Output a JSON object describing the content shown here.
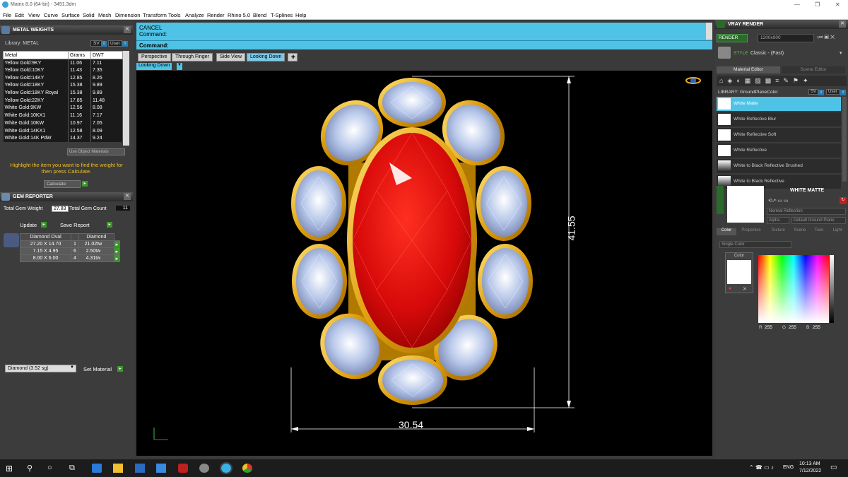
{
  "window": {
    "title": "Matrix 8.0 (64-bit) - 3491.3dm"
  },
  "menu": [
    "File",
    "Edit",
    "View",
    "Curve",
    "Surface",
    "Solid",
    "Mesh",
    "Dimension",
    "Transform",
    "Tools",
    "Analyze",
    "Render",
    "Rhino 5.0",
    "Blend",
    "T-Splines",
    "Help"
  ],
  "metal_weights": {
    "title": "METAL WEIGHTS",
    "library": "Library: METAL",
    "lib_btn_1": "SV",
    "lib_btn_2": "User",
    "columns": [
      "Metal",
      "Grams",
      "DWT"
    ],
    "rows": [
      [
        "Yellow Gold:9KY",
        "11.06",
        "7.11"
      ],
      [
        "Yellow Gold:10KY",
        "11.43",
        "7.35"
      ],
      [
        "Yellow Gold:14KY",
        "12.85",
        "8.26"
      ],
      [
        "Yellow Gold:18KY",
        "15.38",
        "9.89"
      ],
      [
        "Yellow Gold:18KY Royal",
        "15.38",
        "9.89"
      ],
      [
        "Yellow Gold:22KY",
        "17.85",
        "11.48"
      ],
      [
        "White Gold:9KW",
        "12.56",
        "8.08"
      ],
      [
        "White Gold:10KX1",
        "11.16",
        "7.17"
      ],
      [
        "White Gold:10KW",
        "10.97",
        "7.05"
      ],
      [
        "White Gold:14KX1",
        "12.58",
        "8.09"
      ],
      [
        "White Gold:14K PdW",
        "14.37",
        "9.24"
      ]
    ],
    "use_object_materials": "Use Object Materials",
    "hint": "Highlight the item you want to find the weight for then press Calculate.",
    "calculate": "Calculate"
  },
  "gem_reporter": {
    "title": "GEM REPORTER",
    "total_weight_label": "Total Gem Weight",
    "total_weight": "27.83",
    "total_count_label": "Total Gem Count",
    "total_count": "11",
    "update": "Update",
    "save_report": "Save Report",
    "columns": [
      "Diamond Oval",
      "",
      "Diamond"
    ],
    "rows": [
      [
        "27.20 X 14.70",
        "1",
        "21.02tw"
      ],
      [
        "7.15 X 4.95",
        "6",
        "2.50tw"
      ],
      [
        "8.00 X 6.00",
        "4",
        "4.31tw"
      ]
    ],
    "material_select": "Diamond    (3.52 sg)",
    "set_material": "Set Material"
  },
  "command": {
    "line1": "CANCEL",
    "line2": "Command:",
    "prompt": "Command:"
  },
  "view_tabs": [
    "Perspective",
    "Through Finger",
    "Side View",
    "Looking Down"
  ],
  "active_view": "Looking Down",
  "dimensions": {
    "height": "41.55",
    "width": "30.54"
  },
  "vray": {
    "title": "VRAY RENDER",
    "render_btn": "RENDER",
    "resolution": "1200x900",
    "style_label": "STYLE",
    "style_value": "Classic - (Fast)",
    "tab_material": "Material Editor",
    "tab_scene": "Scene Editor",
    "library": "LIBRARY: GroundPlaneColor",
    "lib_btn_1": "SV",
    "lib_btn_2": "User",
    "materials": [
      "White Matte",
      "White Reflective Blur",
      "White Reflective Soft",
      "White Reflective",
      "White to Black Reflective Brushed",
      "White to Black Reflective"
    ],
    "selected_material": "WHITE MATTE",
    "dropdown_reflection": "Normal Reflection",
    "alpha_label": "Alpha",
    "ground_plane": "Default Ground Plane",
    "prop_tabs": [
      "Color",
      "Properties",
      "Texture",
      "Scene",
      "Toon",
      "Light"
    ],
    "color_mode": "Single Color",
    "color_label": "Color",
    "rgb": {
      "r": "255",
      "g": "255",
      "b": "255"
    }
  },
  "taskbar": {
    "lang": "ENG",
    "time": "10:13 AM",
    "date": "7/12/2022"
  },
  "colors": {
    "accent_cyan": "#4ec3e6",
    "gold": "#e8b020",
    "ruby": "#e01010"
  }
}
